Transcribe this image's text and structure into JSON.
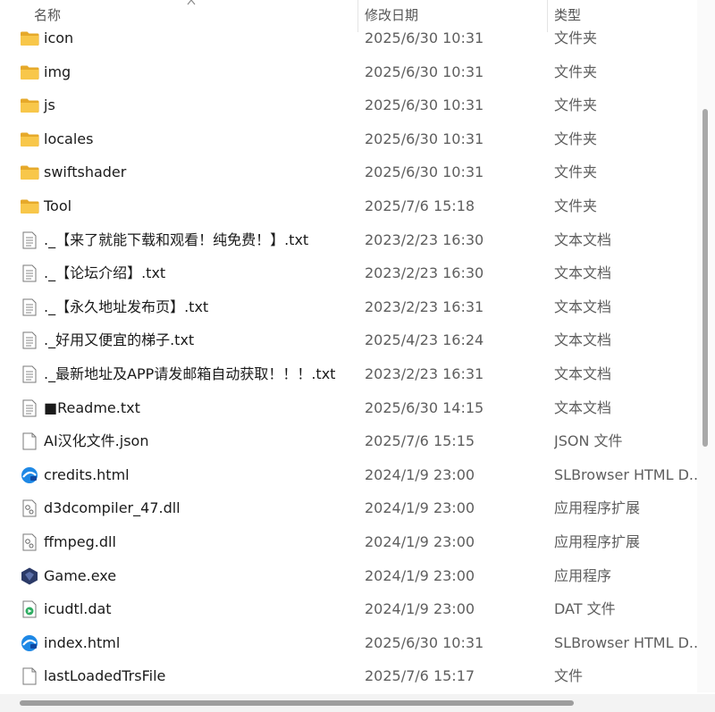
{
  "columns": {
    "name": "名称",
    "date": "修改日期",
    "type": "类型"
  },
  "files": [
    {
      "name": "icon",
      "date": "2025/6/30 10:31",
      "type": "文件夹",
      "icon": "folder-icon"
    },
    {
      "name": "img",
      "date": "2025/6/30 10:31",
      "type": "文件夹",
      "icon": "folder-icon"
    },
    {
      "name": "js",
      "date": "2025/6/30 10:31",
      "type": "文件夹",
      "icon": "folder-icon"
    },
    {
      "name": "locales",
      "date": "2025/6/30 10:31",
      "type": "文件夹",
      "icon": "folder-icon"
    },
    {
      "name": "swiftshader",
      "date": "2025/6/30 10:31",
      "type": "文件夹",
      "icon": "folder-icon"
    },
    {
      "name": "Tool",
      "date": "2025/7/6 15:18",
      "type": "文件夹",
      "icon": "folder-icon"
    },
    {
      "name": "._【来了就能下载和观看！纯免费！】.txt",
      "date": "2023/2/23 16:30",
      "type": "文本文档",
      "icon": "text-file-icon"
    },
    {
      "name": "._【论坛介绍】.txt",
      "date": "2023/2/23 16:30",
      "type": "文本文档",
      "icon": "text-file-icon"
    },
    {
      "name": "._【永久地址发布页】.txt",
      "date": "2023/2/23 16:31",
      "type": "文本文档",
      "icon": "text-file-icon"
    },
    {
      "name": "._好用又便宜的梯子.txt",
      "date": "2025/4/23 16:24",
      "type": "文本文档",
      "icon": "text-file-icon"
    },
    {
      "name": "._最新地址及APP请发邮箱自动获取！！！.txt",
      "date": "2023/2/23 16:31",
      "type": "文本文档",
      "icon": "text-file-icon"
    },
    {
      "name": "■Readme.txt",
      "date": "2025/6/30 14:15",
      "type": "文本文档",
      "icon": "text-file-icon"
    },
    {
      "name": "AI汉化文件.json",
      "date": "2025/7/6 15:15",
      "type": "JSON 文件",
      "icon": "blank-file-icon"
    },
    {
      "name": "credits.html",
      "date": "2024/1/9 23:00",
      "type": "SLBrowser HTML D...",
      "icon": "browser-icon"
    },
    {
      "name": "d3dcompiler_47.dll",
      "date": "2024/1/9 23:00",
      "type": "应用程序扩展",
      "icon": "dll-file-icon"
    },
    {
      "name": "ffmpeg.dll",
      "date": "2024/1/9 23:00",
      "type": "应用程序扩展",
      "icon": "dll-file-icon"
    },
    {
      "name": "Game.exe",
      "date": "2024/1/9 23:00",
      "type": "应用程序",
      "icon": "game-app-icon"
    },
    {
      "name": "icudtl.dat",
      "date": "2024/1/9 23:00",
      "type": "DAT 文件",
      "icon": "media-file-icon"
    },
    {
      "name": "index.html",
      "date": "2025/6/30 10:31",
      "type": "SLBrowser HTML D...",
      "icon": "browser-icon"
    },
    {
      "name": "lastLoadedTrsFile",
      "date": "2025/7/6 15:17",
      "type": "文件",
      "icon": "blank-file-icon"
    }
  ],
  "colors": {
    "folder": "#F7C443",
    "browser": "#1E88E5",
    "game": "#2B3A67"
  }
}
